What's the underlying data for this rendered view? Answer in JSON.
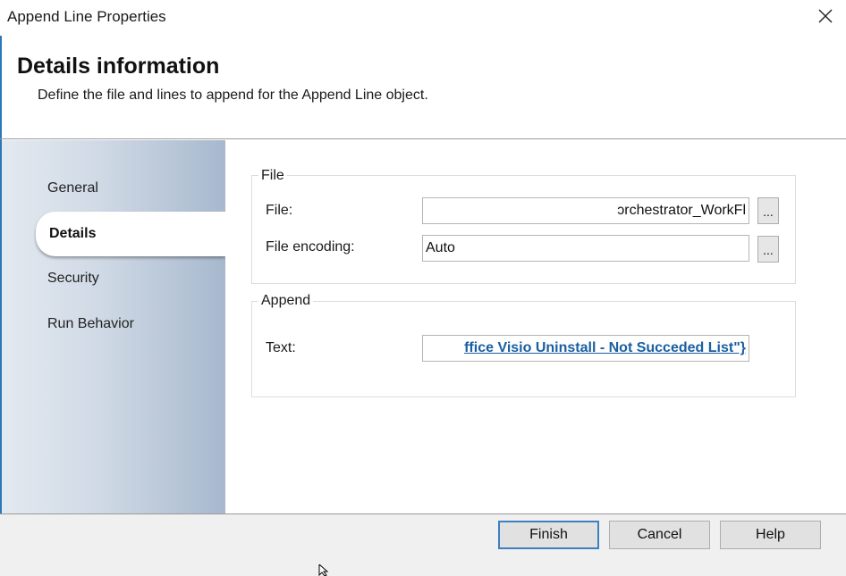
{
  "window": {
    "title": "Append Line Properties",
    "close_icon": "close-icon"
  },
  "header": {
    "title": "Details information",
    "subtitle": "Define the file and lines to append for the Append Line object."
  },
  "nav": {
    "items": [
      {
        "label": "General",
        "selected": false
      },
      {
        "label": "Details",
        "selected": true
      },
      {
        "label": "Security",
        "selected": false
      },
      {
        "label": "Run Behavior",
        "selected": false
      }
    ]
  },
  "file_group": {
    "legend": "File",
    "file_label": "File:",
    "file_value": "ɔrchestrator_WorkFl",
    "file_browse": "...",
    "encoding_label": "File encoding:",
    "encoding_value": "Auto",
    "encoding_browse": "..."
  },
  "append_group": {
    "legend": "Append",
    "text_label": "Text:",
    "text_value": "ffice Visio Uninstall - Not Succeded List\"}"
  },
  "footer": {
    "finish": "Finish",
    "cancel": "Cancel",
    "help": "Help"
  },
  "colors": {
    "accent": "#2b78b8",
    "link": "#1a5fa0",
    "footer_bg": "#f0f0f0"
  }
}
